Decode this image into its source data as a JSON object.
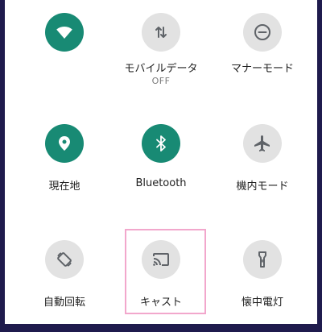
{
  "quick_settings": {
    "tiles": [
      {
        "id": "wifi",
        "label": "",
        "state": "on",
        "icon": "wifi-icon"
      },
      {
        "id": "mobile-data",
        "label": "モバイルデータ",
        "sublabel": "OFF",
        "state": "off",
        "icon": "mobile-data-icon"
      },
      {
        "id": "do-not-disturb",
        "label": "マナーモード",
        "state": "off",
        "icon": "do-not-disturb-icon"
      },
      {
        "id": "location",
        "label": "現在地",
        "state": "on",
        "icon": "location-pin-icon"
      },
      {
        "id": "bluetooth",
        "label": "Bluetooth",
        "state": "on",
        "icon": "bluetooth-icon"
      },
      {
        "id": "airplane-mode",
        "label": "機内モード",
        "state": "off",
        "icon": "airplane-icon"
      },
      {
        "id": "auto-rotate",
        "label": "自動回転",
        "state": "off",
        "icon": "auto-rotate-icon"
      },
      {
        "id": "cast",
        "label": "キャスト",
        "state": "off",
        "icon": "cast-icon"
      },
      {
        "id": "flashlight",
        "label": "懐中電灯",
        "state": "off",
        "icon": "flashlight-icon"
      }
    ]
  },
  "colors": {
    "active": "#188a74",
    "inactive": "#e2e2e2",
    "icon_inactive": "#5f6368",
    "highlight": "#f2a7cc"
  }
}
